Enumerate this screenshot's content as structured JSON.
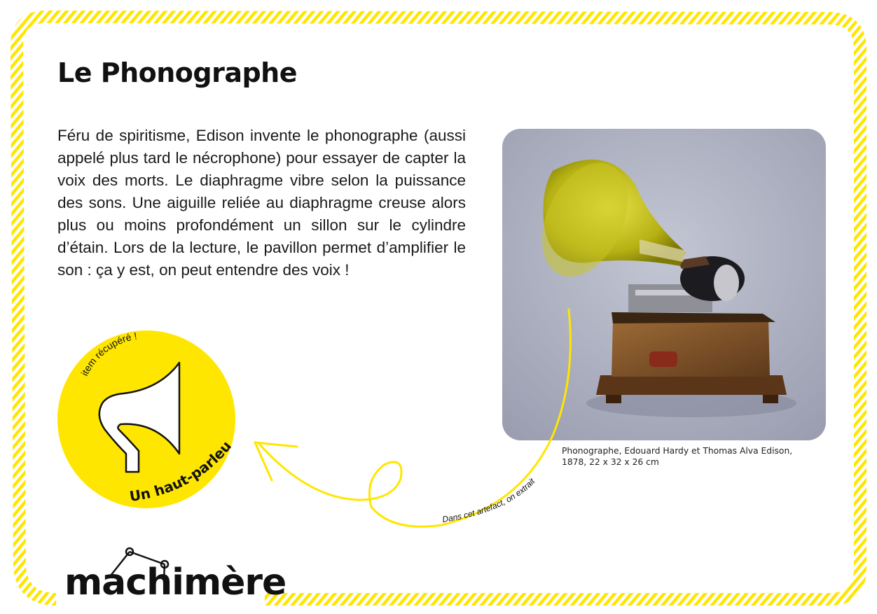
{
  "page": {
    "title": "Le Phonographe",
    "description": "Féru de spiritisme, Edison invente le phonographe (aussi appelé plus tard le nécrophone) pour essayer de capter la voix des morts. Le diaphragme vibre selon la puissance des sons. Une aiguille reliée au diaphragme creuse alors plus ou moins profondément un sillon sur le cylindre d’étain. Lors de la lecture, le pavillon permet d’amplifier le son : ça y est, on peut entendre des voix !"
  },
  "photo": {
    "caption": "Phonographe, Edouard Hardy et Thomas Alva Edison, 1878, 22 x 32 x 26 cm"
  },
  "badge": {
    "top_label": "item récupéré !",
    "bottom_label": "Un haut-parleur",
    "icon": "loudspeaker-horn-icon"
  },
  "arrow": {
    "label": "Dans cet artefact, on extrait"
  },
  "logo": {
    "text": "machimère"
  },
  "colors": {
    "accent_yellow": "#ffe600",
    "text": "#111111",
    "photo_background": "#a9adbd"
  }
}
